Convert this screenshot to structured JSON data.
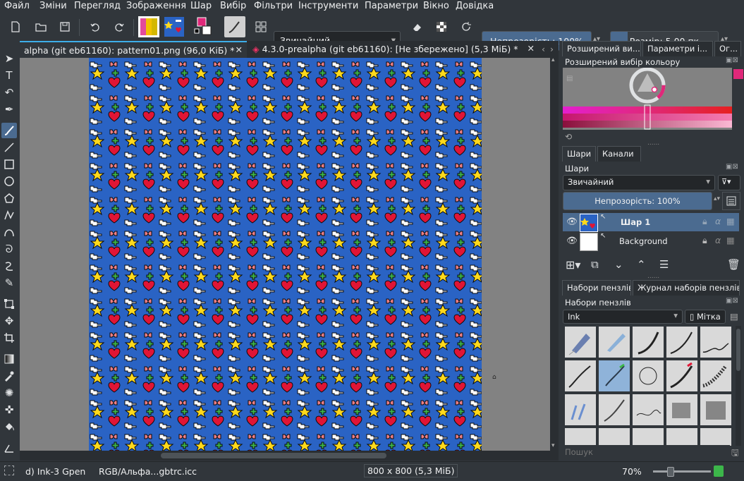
{
  "menu": [
    "Файл",
    "Зміни",
    "Перегляд",
    "Зображення",
    "Шар",
    "Вибір",
    "Фільтри",
    "Інструменти",
    "Параметри",
    "Вікно",
    "Довідка"
  ],
  "toolbar": {
    "blend_mode": "Звичайний",
    "opacity_label": "Непрозорість:  100%",
    "opacity_value": 1.0,
    "size_label": "Розмір:  5,00 пк",
    "fg_color": "#e0287a",
    "bg_color": "#ffffff"
  },
  "tabs": [
    {
      "label": "alpha (git eb61160): pattern01.png (96,0 КіБ) *"
    },
    {
      "label": "4.3.0-prealpha (git eb61160):  [Не збережено]  (5,3 МіБ) *"
    }
  ],
  "dock": {
    "top_tabs": [
      "Розширений ви...",
      "Параметри і...",
      "Ог..."
    ],
    "color_title": "Розширений вибір кольору",
    "layers_tabs": [
      "Шари",
      "Канали"
    ],
    "layers_title": "Шари",
    "layers_blend": "Звичайний",
    "layers_opacity": "Непрозорість:  100%",
    "layers": [
      {
        "name": "Шар 1",
        "selected": true
      },
      {
        "name": "Background",
        "selected": false
      }
    ],
    "brush_tabs": [
      "Набори пензлів",
      "Журнал наборів пензлів"
    ],
    "brush_title": "Набори пензлів",
    "brush_filter": "Ink",
    "brush_tag": "Мітка",
    "search_placeholder": "Пошук"
  },
  "status": {
    "brush": "d) Ink-3 Gpen",
    "color_profile": "RGB/Альфа...gbtrc.icc",
    "image_size": "800 x 800 (5,3 МіБ)",
    "zoom": "70%"
  },
  "colors": {
    "accent": "#4b6b90",
    "pattern_bg": "#2a63c4",
    "star": "#ffd91c",
    "heart": "#e01535",
    "wing": "#ffffff",
    "bow": "#ec7f86",
    "clover": "#3cb64a"
  }
}
